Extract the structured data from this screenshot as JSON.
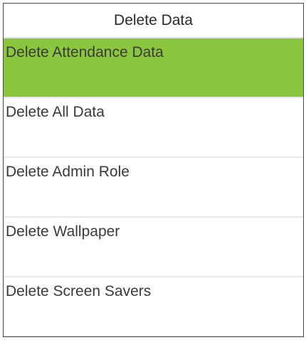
{
  "header": {
    "title": "Delete Data"
  },
  "menu": {
    "items": [
      {
        "label": "Delete Attendance Data",
        "selected": true
      },
      {
        "label": "Delete All Data",
        "selected": false
      },
      {
        "label": "Delete Admin Role",
        "selected": false
      },
      {
        "label": "Delete Wallpaper",
        "selected": false
      },
      {
        "label": "Delete Screen Savers",
        "selected": false
      }
    ]
  },
  "colors": {
    "selected_background": "#8cc63f",
    "text": "#3a3a3a",
    "divider": "#e8e8e8"
  }
}
